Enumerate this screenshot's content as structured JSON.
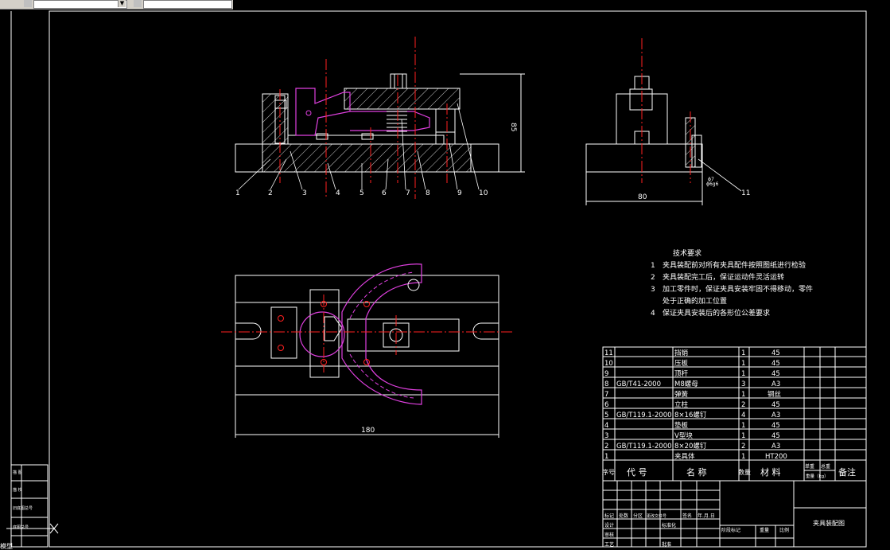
{
  "toolbar": {
    "layer_combo_value": "",
    "style_combo_value": ""
  },
  "dimensions": {
    "height": "85",
    "front_width": "80",
    "top_length": "180",
    "tol_top": "ϕ7",
    "tol_bottom": "ϕ6g6"
  },
  "balloons": [
    "1",
    "2",
    "3",
    "4",
    "5",
    "6",
    "7",
    "8",
    "9",
    "10",
    "11"
  ],
  "tech_req": {
    "title": "技术要求",
    "items": [
      {
        "num": "1",
        "text": "夹具装配前对所有夹具配件按照图纸进行检验"
      },
      {
        "num": "2",
        "text": "夹具装配完工后，保证运动件灵活运转"
      },
      {
        "num": "3",
        "text": "加工零件时，保证夹具安装牢固不得移动，零件"
      },
      {
        "num": "",
        "text": "处于正确的加工位置"
      },
      {
        "num": "4",
        "text": "保证夹具安装后的各形位公差要求"
      }
    ]
  },
  "bom": {
    "rows": [
      {
        "no": "11",
        "code": "",
        "name": "挡销",
        "qty": "1",
        "mat": "45"
      },
      {
        "no": "10",
        "code": "",
        "name": "压板",
        "qty": "1",
        "mat": "45"
      },
      {
        "no": "9",
        "code": "",
        "name": "顶杆",
        "qty": "1",
        "mat": "45"
      },
      {
        "no": "8",
        "code": "GB/T41-2000",
        "name": "M8螺母",
        "qty": "3",
        "mat": "A3"
      },
      {
        "no": "7",
        "code": "",
        "name": "弹簧",
        "qty": "1",
        "mat": "钢丝"
      },
      {
        "no": "6",
        "code": "",
        "name": "立柱",
        "qty": "2",
        "mat": "45"
      },
      {
        "no": "5",
        "code": "GB/T119.1-2000",
        "name": "8×16螺钉",
        "qty": "4",
        "mat": "A3"
      },
      {
        "no": "4",
        "code": "",
        "name": "垫板",
        "qty": "1",
        "mat": "45"
      },
      {
        "no": "3",
        "code": "",
        "name": "V型块",
        "qty": "1",
        "mat": "45"
      },
      {
        "no": "2",
        "code": "GB/T119.1-2000",
        "name": "8×20螺钉",
        "qty": "2",
        "mat": "A3"
      },
      {
        "no": "1",
        "code": "",
        "name": "夹具体",
        "qty": "1",
        "mat": "HT200"
      }
    ],
    "header": {
      "no": "序号",
      "code": "代 号",
      "name": "名 称",
      "qty": "数量",
      "mat": "材 料",
      "wt1": "单重",
      "wt2": "总重",
      "wt3": "重量（kg）",
      "remark": "备注"
    }
  },
  "title_block": {
    "drawing_name": "夹具装配图",
    "labels": {
      "mark": "标记",
      "count": "处数",
      "zone": "分区",
      "changedoc": "更改文件号",
      "sign": "签名",
      "date": "年.月.日",
      "design": "设计",
      "standard": "标准化",
      "stage": "阶段标记",
      "weight": "重量",
      "scale": "比例",
      "audit": "审核",
      "craft": "工艺",
      "approve": "批准"
    }
  },
  "left_stamp": {
    "cells": [
      "描 图",
      "描 校",
      "旧底图总号",
      "底图总号"
    ]
  },
  "command_line": {
    "text": "模型"
  }
}
